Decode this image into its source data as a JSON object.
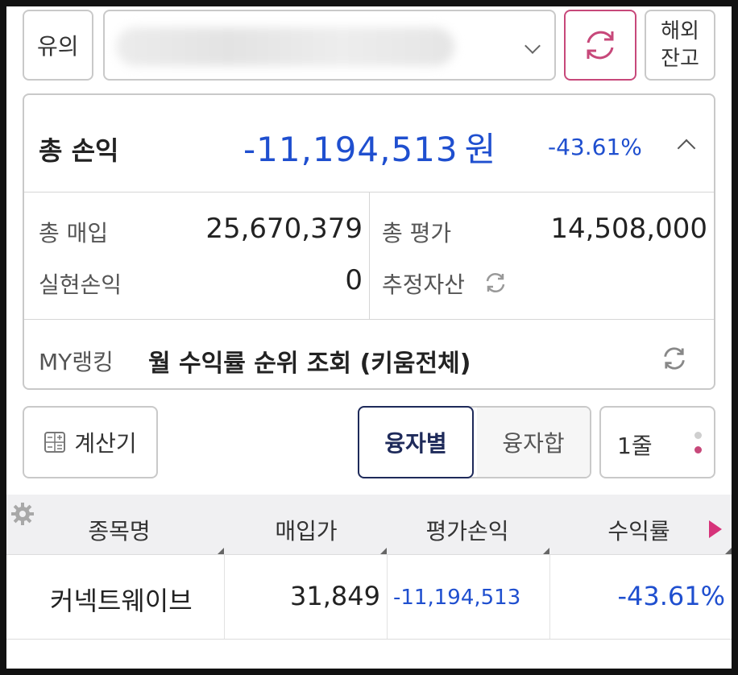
{
  "top": {
    "account_type": "유의",
    "overseas_label_line1": "해외",
    "overseas_label_line2": "잔고"
  },
  "summary": {
    "title": "총 손익",
    "amount": "-11,194,513",
    "currency": "원",
    "rate": "-43.61%",
    "purchase_label": "총 매입",
    "purchase_value": "25,670,379",
    "evaluation_label": "총 평가",
    "evaluation_value": "14,508,000",
    "realized_label": "실현손익",
    "realized_value": "0",
    "estimated_label": "추정자산",
    "my_ranking_label": "MY랭킹",
    "my_ranking_text": "월 수익률 순위 조회 (키움전체)"
  },
  "controls": {
    "calculator_label": "계산기",
    "seg_active": "융자별",
    "seg_inactive": "융자합",
    "rows_label": "1줄"
  },
  "table": {
    "headers": [
      "종목명",
      "매입가",
      "평가손익",
      "수익률"
    ],
    "rows": [
      {
        "name": "커넥트웨이브",
        "price": "31,849",
        "pnl": "-11,194,513",
        "rate": "-43.61%"
      }
    ]
  },
  "colors": {
    "loss_blue": "#1f4fcf",
    "accent_pink": "#d6337a",
    "segment_navy": "#1e2a5a"
  }
}
